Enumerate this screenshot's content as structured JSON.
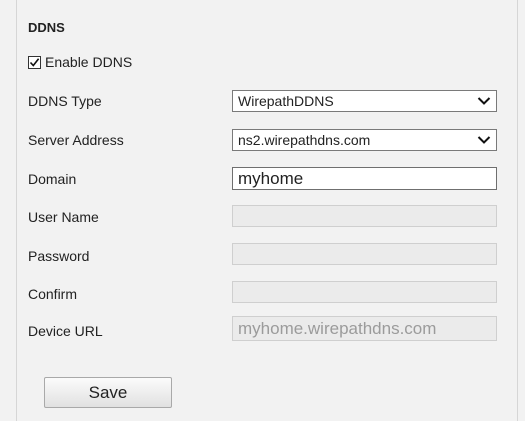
{
  "section": {
    "title": "DDNS"
  },
  "enable": {
    "label": "Enable DDNS",
    "checked": true
  },
  "fields": {
    "ddns_type": {
      "label": "DDNS Type",
      "value": "WirepathDDNS"
    },
    "server_address": {
      "label": "Server Address",
      "value": "ns2.wirepathdns.com"
    },
    "domain": {
      "label": "Domain",
      "value": "myhome"
    },
    "user_name": {
      "label": "User Name",
      "value": ""
    },
    "password": {
      "label": "Password",
      "value": ""
    },
    "confirm": {
      "label": "Confirm",
      "value": ""
    },
    "device_url": {
      "label": "Device URL",
      "value": "myhome.wirepathdns.com"
    }
  },
  "actions": {
    "save_label": "Save"
  }
}
